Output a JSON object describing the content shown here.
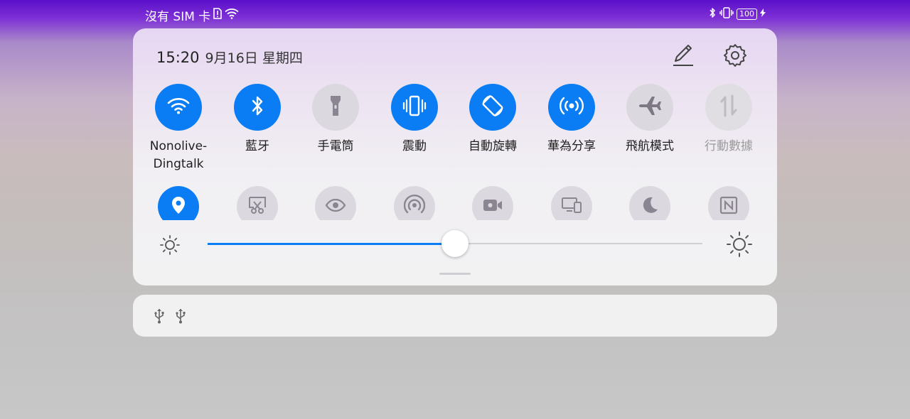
{
  "status_bar": {
    "carrier_text": "沒有 SIM 卡",
    "battery_text": "100"
  },
  "panel": {
    "time": "15:20",
    "date": "9月16日 星期四",
    "brightness_fraction": 0.5,
    "toggles": [
      {
        "label": "Nonolive-\nDingtalk",
        "icon": "wifi-icon",
        "state": "on"
      },
      {
        "label": "藍牙",
        "icon": "bluetooth-icon",
        "state": "on"
      },
      {
        "label": "手電筒",
        "icon": "flashlight-icon",
        "state": "off"
      },
      {
        "label": "震動",
        "icon": "vibrate-icon",
        "state": "on"
      },
      {
        "label": "自動旋轉",
        "icon": "auto-rotate-icon",
        "state": "on"
      },
      {
        "label": "華為分享",
        "icon": "huawei-share-icon",
        "state": "on"
      },
      {
        "label": "飛航模式",
        "icon": "airplane-icon",
        "state": "off"
      },
      {
        "label": "行動數據",
        "icon": "mobile-data-icon",
        "state": "disabled"
      }
    ],
    "second_row": [
      {
        "icon": "location-icon",
        "state": "on"
      },
      {
        "icon": "screenshot-icon",
        "state": "off"
      },
      {
        "icon": "eye-comfort-icon",
        "state": "off"
      },
      {
        "icon": "hotspot-icon",
        "state": "off"
      },
      {
        "icon": "screen-record-icon",
        "state": "off"
      },
      {
        "icon": "multi-screen-icon",
        "state": "off"
      },
      {
        "icon": "dark-mode-icon",
        "state": "off"
      },
      {
        "icon": "nfc-icon",
        "state": "off"
      }
    ]
  },
  "colors": {
    "accent": "#0a7df5",
    "tile_off": "#dcd8df"
  }
}
